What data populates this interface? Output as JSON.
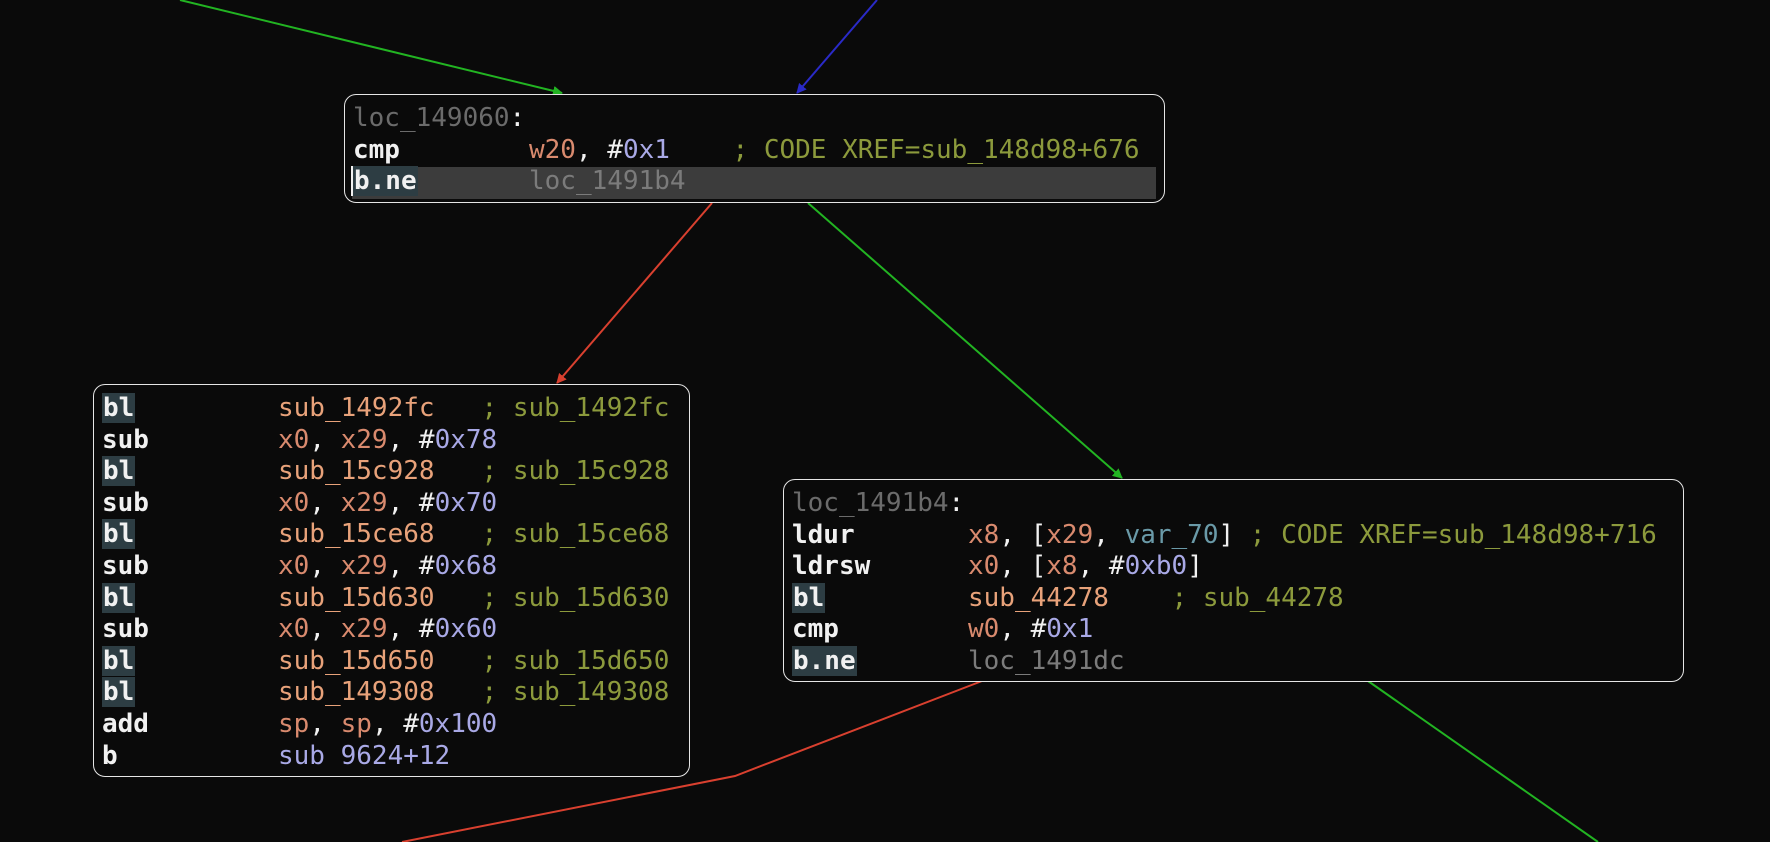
{
  "colors": {
    "background": "#0a0a0a",
    "edge_true": "#22b422",
    "edge_false": "#d9402f",
    "edge_uncond": "#2a2ac8",
    "block_border": "#e6e6e6",
    "highlight": "#3c3c3c"
  },
  "blocks": {
    "b1": {
      "label": "loc_149060",
      "rows": [
        {
          "mn": "cmp",
          "ops": [
            [
              "reg",
              "w20"
            ],
            [
              "punc",
              ", "
            ],
            [
              "hash",
              "#"
            ],
            [
              "num",
              "0x1"
            ],
            [
              "punc",
              "    "
            ],
            [
              "cmt",
              "; CODE XREF=sub_148d98+676"
            ]
          ]
        },
        {
          "mn": "b.ne",
          "chip": true,
          "hl": true,
          "ops": [
            [
              "loc",
              "loc_1491b4"
            ]
          ]
        }
      ]
    },
    "b2": {
      "rows": [
        {
          "mn": "bl",
          "chip": true,
          "ops": [
            [
              "sym",
              "sub_1492fc"
            ],
            [
              "punc",
              "   "
            ],
            [
              "cmt",
              "; sub_1492fc"
            ]
          ]
        },
        {
          "mn": "sub",
          "ops": [
            [
              "reg",
              "x0"
            ],
            [
              "punc",
              ", "
            ],
            [
              "reg",
              "x29"
            ],
            [
              "punc",
              ", "
            ],
            [
              "hash",
              "#"
            ],
            [
              "num",
              "0x78"
            ]
          ]
        },
        {
          "mn": "bl",
          "chip": true,
          "ops": [
            [
              "sym",
              "sub_15c928"
            ],
            [
              "punc",
              "   "
            ],
            [
              "cmt",
              "; sub_15c928"
            ]
          ]
        },
        {
          "mn": "sub",
          "ops": [
            [
              "reg",
              "x0"
            ],
            [
              "punc",
              ", "
            ],
            [
              "reg",
              "x29"
            ],
            [
              "punc",
              ", "
            ],
            [
              "hash",
              "#"
            ],
            [
              "num",
              "0x70"
            ]
          ]
        },
        {
          "mn": "bl",
          "chip": true,
          "ops": [
            [
              "sym",
              "sub_15ce68"
            ],
            [
              "punc",
              "   "
            ],
            [
              "cmt",
              "; sub_15ce68"
            ]
          ]
        },
        {
          "mn": "sub",
          "ops": [
            [
              "reg",
              "x0"
            ],
            [
              "punc",
              ", "
            ],
            [
              "reg",
              "x29"
            ],
            [
              "punc",
              ", "
            ],
            [
              "hash",
              "#"
            ],
            [
              "num",
              "0x68"
            ]
          ]
        },
        {
          "mn": "bl",
          "chip": true,
          "ops": [
            [
              "sym",
              "sub_15d630"
            ],
            [
              "punc",
              "   "
            ],
            [
              "cmt",
              "; sub_15d630"
            ]
          ]
        },
        {
          "mn": "sub",
          "ops": [
            [
              "reg",
              "x0"
            ],
            [
              "punc",
              ", "
            ],
            [
              "reg",
              "x29"
            ],
            [
              "punc",
              ", "
            ],
            [
              "hash",
              "#"
            ],
            [
              "num",
              "0x60"
            ]
          ]
        },
        {
          "mn": "bl",
          "chip": true,
          "ops": [
            [
              "sym",
              "sub_15d650"
            ],
            [
              "punc",
              "   "
            ],
            [
              "cmt",
              "; sub_15d650"
            ]
          ]
        },
        {
          "mn": "bl",
          "chip": true,
          "ops": [
            [
              "sym",
              "sub_149308"
            ],
            [
              "punc",
              "   "
            ],
            [
              "cmt",
              "; sub_149308"
            ]
          ]
        },
        {
          "mn": "add",
          "ops": [
            [
              "reg",
              "sp"
            ],
            [
              "punc",
              ", "
            ],
            [
              "reg",
              "sp"
            ],
            [
              "punc",
              ", "
            ],
            [
              "hash",
              "#"
            ],
            [
              "num",
              "0x100"
            ]
          ]
        },
        {
          "mn": "b",
          "ops": [
            [
              "raw",
              "sub 9624+12"
            ]
          ]
        }
      ]
    },
    "b3": {
      "label": "loc_1491b4",
      "rows": [
        {
          "mn": "ldur",
          "ops": [
            [
              "reg",
              "x8"
            ],
            [
              "punc",
              ", ["
            ],
            [
              "reg",
              "x29"
            ],
            [
              "punc",
              ", "
            ],
            [
              "var",
              "var_70"
            ],
            [
              "punc",
              "] "
            ],
            [
              "cmt",
              "; CODE XREF=sub_148d98+716"
            ]
          ]
        },
        {
          "mn": "ldrsw",
          "ops": [
            [
              "reg",
              "x0"
            ],
            [
              "punc",
              ", ["
            ],
            [
              "reg",
              "x8"
            ],
            [
              "punc",
              ", "
            ],
            [
              "hash",
              "#"
            ],
            [
              "num",
              "0xb0"
            ],
            [
              "punc",
              "]"
            ]
          ]
        },
        {
          "mn": "bl",
          "chip": true,
          "ops": [
            [
              "sym",
              "sub_44278"
            ],
            [
              "punc",
              "    "
            ],
            [
              "cmt",
              "; sub_44278"
            ]
          ]
        },
        {
          "mn": "cmp",
          "ops": [
            [
              "reg",
              "w0"
            ],
            [
              "punc",
              ", "
            ],
            [
              "hash",
              "#"
            ],
            [
              "num",
              "0x1"
            ]
          ]
        },
        {
          "mn": "b.ne",
          "chip": true,
          "ops": [
            [
              "loc",
              "loc_1491dc"
            ]
          ]
        }
      ]
    }
  }
}
